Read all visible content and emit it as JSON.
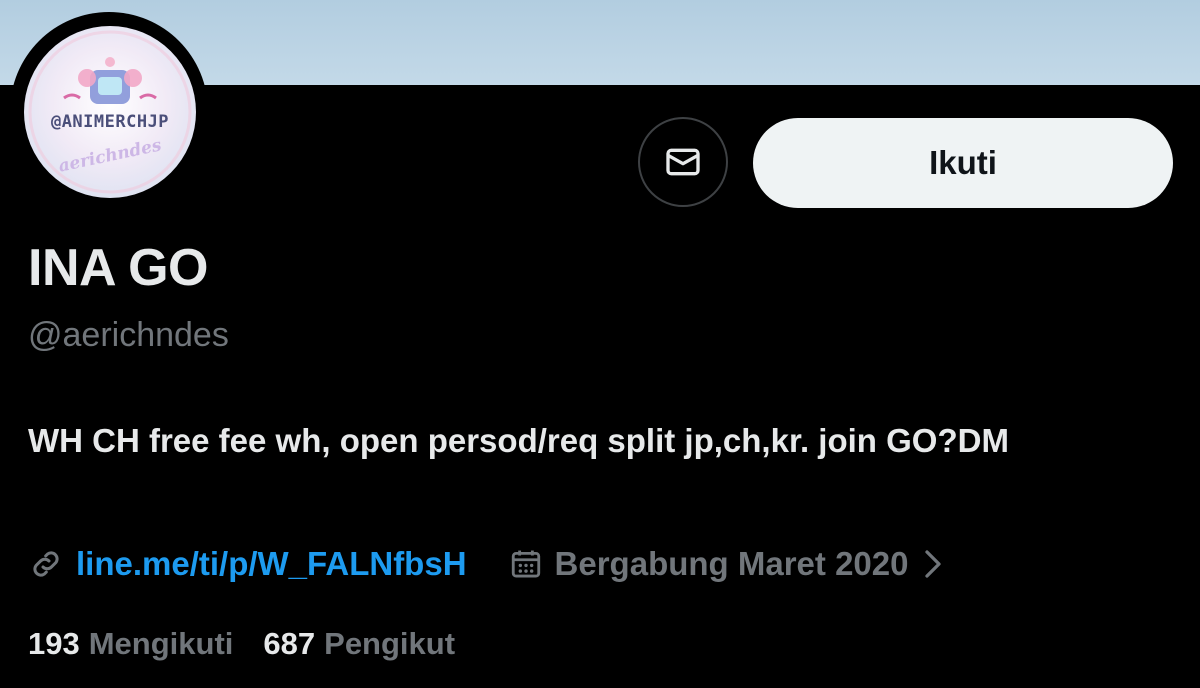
{
  "profile": {
    "avatar_text": "@ANIMERCHJP",
    "avatar_subtext": "aerichndes",
    "display_name": "INA GO",
    "handle": "@aerichndes",
    "bio": "WH CH free fee wh, open persod/req split jp,ch,kr. join GO?DM",
    "link": "line.me/ti/p/W_FALNfbsH",
    "joined": "Bergabung Maret 2020"
  },
  "actions": {
    "message_icon": "envelope-icon",
    "follow_label": "Ikuti"
  },
  "stats": {
    "following_count": "193",
    "following_label": "Mengikuti",
    "followers_count": "687",
    "followers_label": "Pengikut"
  },
  "colors": {
    "background": "#000000",
    "banner": "#b9d2e4",
    "link": "#1d9bf0",
    "muted": "#71767b",
    "text": "#e7e9ea",
    "follow_button": "#eff3f4"
  }
}
